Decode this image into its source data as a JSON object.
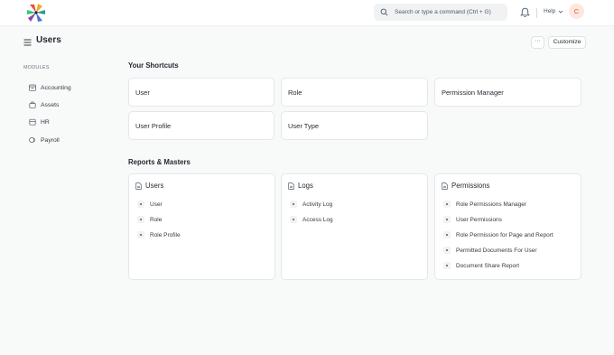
{
  "topbar": {
    "search_placeholder": "Search or type a command (Ctrl + G)",
    "help_label": "Help",
    "avatar_initial": "C"
  },
  "page": {
    "title": "Users",
    "more_label": "···",
    "customize_label": "Customize"
  },
  "sidebar": {
    "section_label": "MODULES",
    "items": [
      {
        "label": "Accounting",
        "icon": "accounting-icon"
      },
      {
        "label": "Assets",
        "icon": "assets-icon"
      },
      {
        "label": "HR",
        "icon": "hr-icon"
      },
      {
        "label": "Payroll",
        "icon": "payroll-icon"
      }
    ]
  },
  "shortcuts": {
    "title": "Your Shortcuts",
    "items": [
      "User",
      "Role",
      "Permission Manager",
      "User Profile",
      "User Type"
    ]
  },
  "reports": {
    "title": "Reports & Masters",
    "cards": [
      {
        "title": "Users",
        "links": [
          "User",
          "Role",
          "Role Profile"
        ]
      },
      {
        "title": "Logs",
        "links": [
          "Activity Log",
          "Access Log"
        ]
      },
      {
        "title": "Permissions",
        "links": [
          "Role Permissions Manager",
          "User Permissions",
          "Role Permission for Page and Report",
          "Permitted Documents For User",
          "Document Share Report"
        ]
      }
    ]
  },
  "colors": {
    "background": "#f8f9f9",
    "card": "#ffffff",
    "avatar_bg": "#fde7df",
    "avatar_text": "#d35d2e"
  }
}
